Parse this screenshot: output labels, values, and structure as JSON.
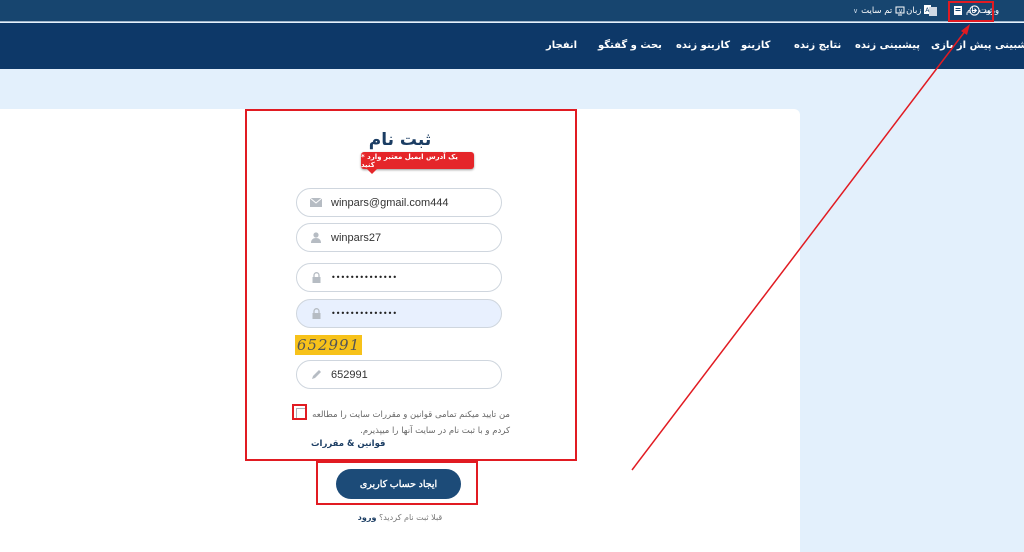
{
  "topbar": {
    "login": "ورود",
    "register": "ثبت نام",
    "language": "زبان",
    "theme": "تم سایت"
  },
  "nav": [
    "پیشبینی پیش از بازی",
    "پیشبینی زنده",
    "نتایج زنده",
    "کازینو",
    "کازینو زنده",
    "بحث و گفتگو",
    "انفجار"
  ],
  "form": {
    "title": "ثبت نام",
    "tooltip": "* یک آدرس ایمیل معتبر وارد کنید",
    "email_value": "winpars@gmail.com444",
    "username_value": "winpars27",
    "password_dots": "••••••••••••••",
    "password_confirm_dots": "••••••••••••••",
    "captcha_text": "652991",
    "captcha_value": "652991",
    "terms_text": "من تایید میکنم تمامی قوانین و مقررات سایت را مطالعه کردم و با ثبت نام در سایت آنها را میپذیرم.",
    "terms_link": "قوانین & مقررات",
    "submit_label": "ایجاد حساب کاربری",
    "already_text": "قبلا ثبت نام کردید؟",
    "login_link": "ورود"
  },
  "colors": {
    "topbar": "#17456f",
    "navbar": "#0d3868",
    "background": "#e3f0fc",
    "button": "#1c4b78",
    "annotation": "#e11b22",
    "captcha": "#f7c21a"
  },
  "icons": {
    "email": "envelope-icon",
    "username": "user-icon",
    "password": "lock-icon",
    "captcha": "pencil-icon"
  }
}
